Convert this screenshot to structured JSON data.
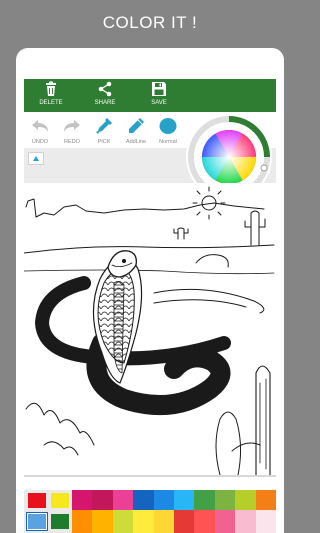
{
  "banner": {
    "title": "COLOR IT !"
  },
  "toolbar": {
    "items": [
      {
        "label": "DELETE",
        "icon": "trash-icon"
      },
      {
        "label": "SHARE",
        "icon": "share-icon"
      },
      {
        "label": "SAVE",
        "icon": "save-icon"
      }
    ]
  },
  "tools": {
    "items": [
      {
        "label": "UNDO",
        "icon": "undo-icon"
      },
      {
        "label": "REDO",
        "icon": "redo-icon"
      },
      {
        "label": "PICK",
        "icon": "eyedropper-icon"
      },
      {
        "label": "AddLine",
        "icon": "pencil-icon"
      },
      {
        "label": "Normal",
        "icon": "brush-dot-icon"
      }
    ]
  },
  "colors": {
    "toolbar_bg": "#2e7d32",
    "tool_accent": "#26a1c9",
    "tool_disabled": "#c2c2c2",
    "wheel_ring_active": "#2e7d32"
  },
  "palette": {
    "fixed": [
      "#e8101c",
      "#f6e81c",
      "#5aa2e0",
      "#1e7d2c"
    ],
    "selected_fixed": 2,
    "grid": [
      "#d6156c",
      "#c2185b",
      "#ec3f96",
      "#1565c0",
      "#1e88e5",
      "#29b6f6",
      "#43a047",
      "#7cb342",
      "#b6ce2a",
      "#f57f17",
      "#ff8f00",
      "#ffb300",
      "#cddc39",
      "#ffeb3b",
      "#fdd835",
      "#e53935",
      "#ff5252",
      "#f06292",
      "#f8bbd0",
      "#fce4ec"
    ]
  }
}
